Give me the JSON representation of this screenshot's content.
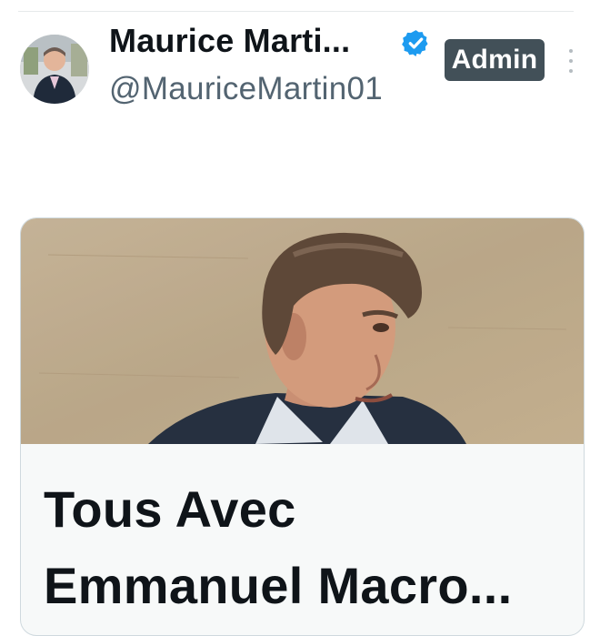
{
  "post": {
    "author": {
      "display_name": "Maurice Marti...",
      "handle": "@MauriceMartin01",
      "verified": true,
      "badge": "Admin",
      "avatar_icon": "avatar-photo"
    },
    "more_icon": "more-vertical-icon",
    "card": {
      "image_icon": "link-preview-photo",
      "title_lines": [
        "Tous Avec",
        "Emmanuel Macro..."
      ]
    }
  },
  "colors": {
    "verified_blue": "#1d9bf0",
    "badge_background": "#425058",
    "handle_gray": "#536471"
  }
}
